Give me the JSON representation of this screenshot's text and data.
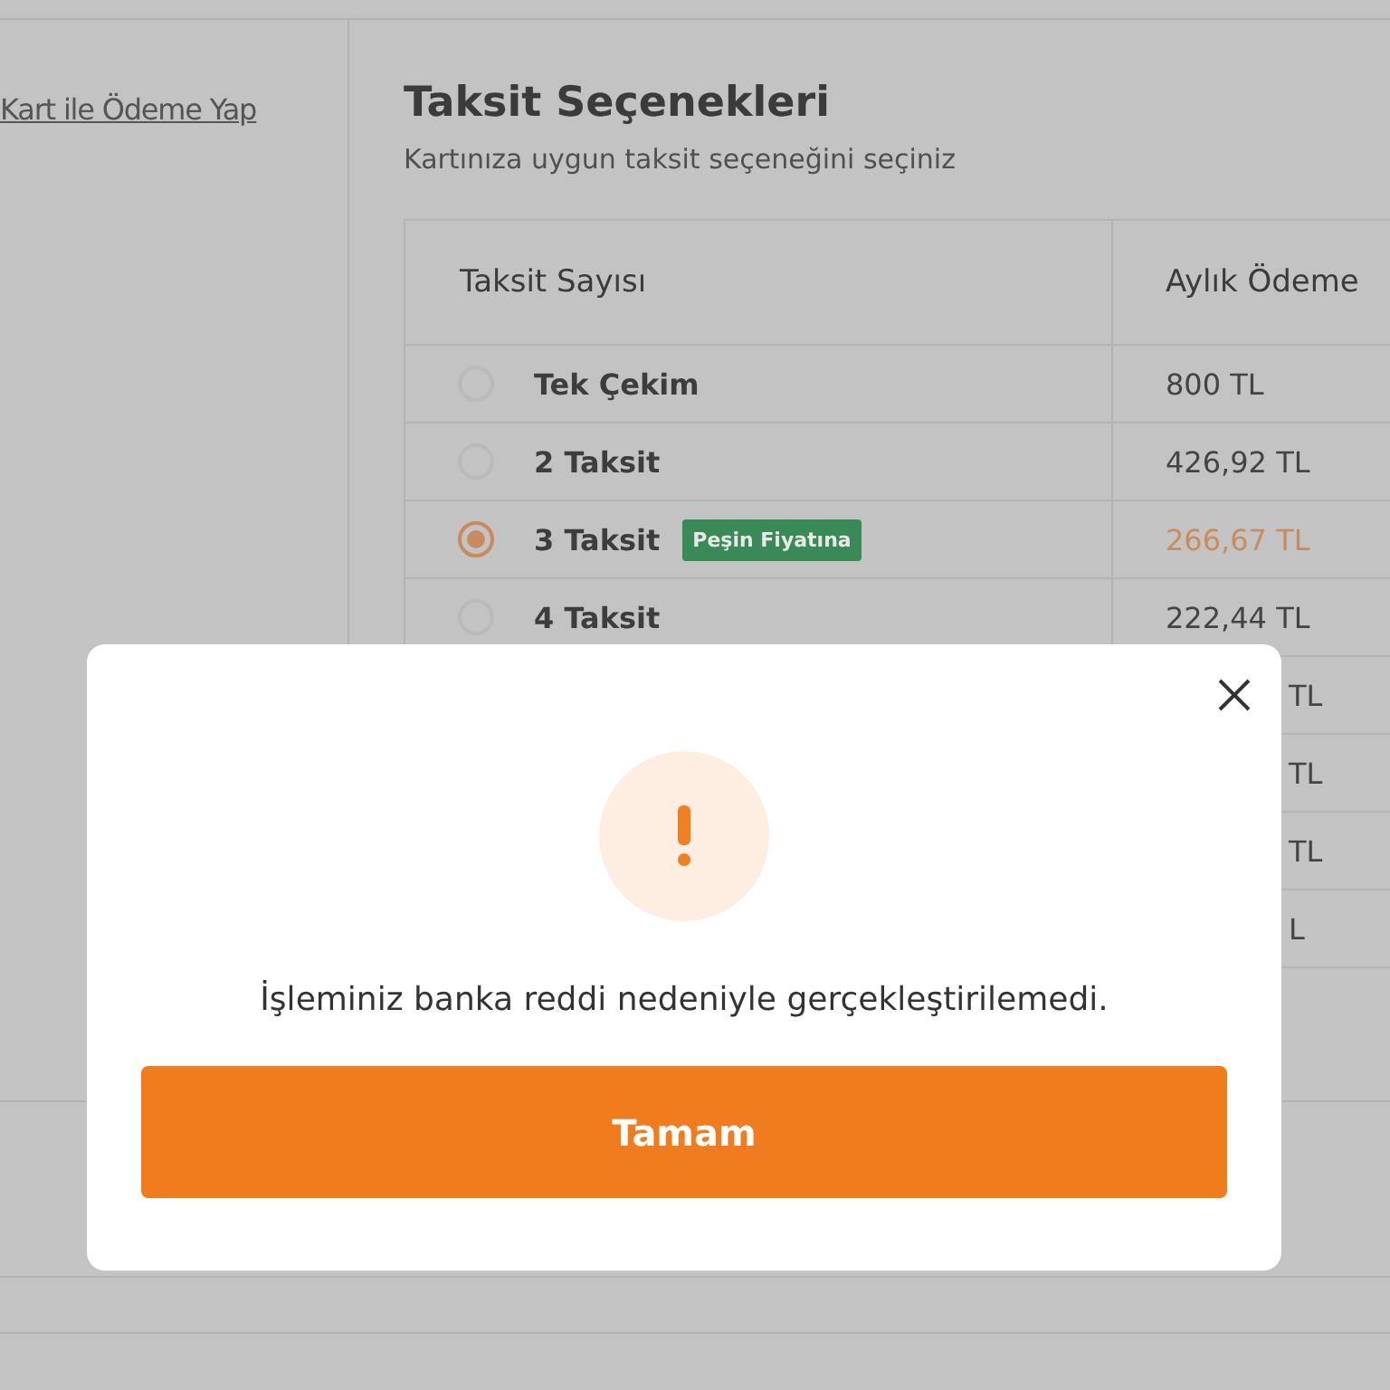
{
  "sidebar": {
    "link": "Kart ile Ödeme Yap"
  },
  "installments": {
    "title": "Taksit Seçenekleri",
    "subtitle": "Kartınıza uygun taksit seçeneğini seçiniz",
    "columns": [
      "Taksit Sayısı",
      "Aylık Ödeme"
    ],
    "rows": [
      {
        "label": "Tek Çekim",
        "amount": "800 TL",
        "selected": false
      },
      {
        "label": "2 Taksit",
        "amount": "426,92 TL",
        "selected": false
      },
      {
        "label": "3 Taksit",
        "badge": "Peşin Fiyatına",
        "amount": "266,67 TL",
        "selected": true
      },
      {
        "label": "4 Taksit",
        "amount": "222,44 TL",
        "selected": false
      },
      {
        "amount": "TL",
        "partial": true
      },
      {
        "amount": "TL",
        "partial": true
      },
      {
        "amount": "TL",
        "partial": true
      },
      {
        "amount": "L",
        "partial": true
      }
    ]
  },
  "dialog": {
    "message": "İşleminiz banka reddi nedeniyle gerçekleştirilemedi.",
    "button": "Tamam"
  }
}
